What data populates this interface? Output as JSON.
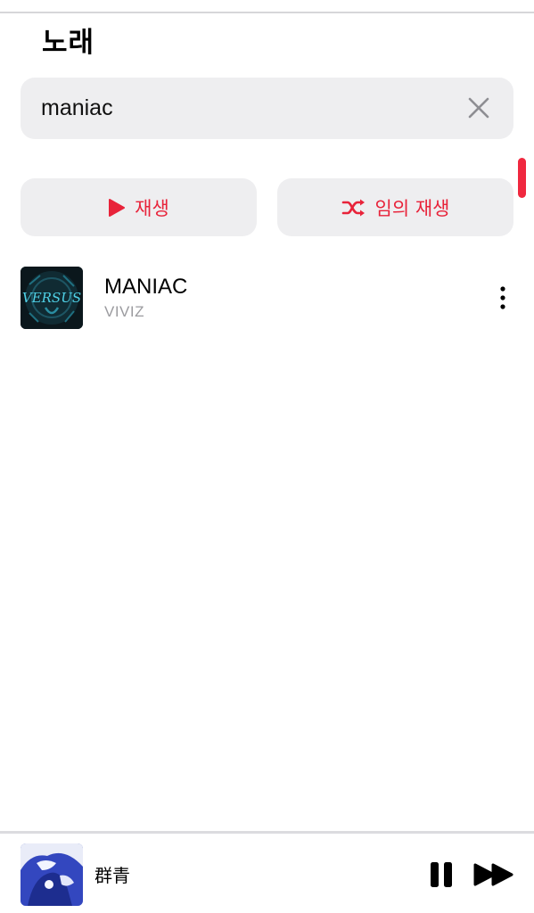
{
  "header": {
    "title": "노래"
  },
  "search": {
    "value": "maniac",
    "clear_icon": "close-icon"
  },
  "actions": {
    "play_label": "재생",
    "play_icon": "play-icon",
    "shuffle_label": "임의 재생",
    "shuffle_icon": "shuffle-icon"
  },
  "results": [
    {
      "title": "MANIAC",
      "artist": "VIVIZ",
      "artwork_text": "VERSUS",
      "menu_icon": "more-vertical-icon"
    }
  ],
  "now_playing": {
    "title": "群青",
    "pause_icon": "pause-icon",
    "forward_icon": "fast-forward-icon"
  },
  "colors": {
    "accent": "#e8233a",
    "scroll_indicator": "#f0283f",
    "field_background": "#eeeef0",
    "secondary_text": "#9b9b9f"
  }
}
